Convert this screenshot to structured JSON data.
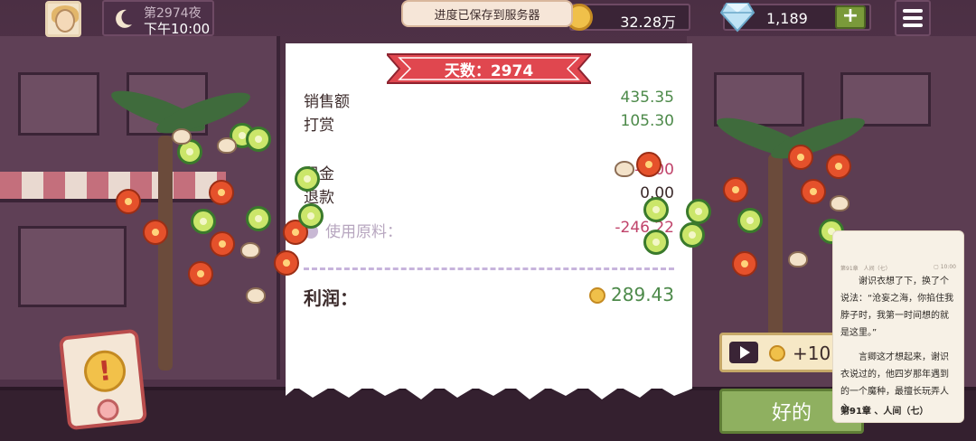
{
  "top_bar": {
    "night_label": "第2974夜",
    "time_label": "下午10:00",
    "coins": "32.28万",
    "gems": "1,189",
    "add_label": "+"
  },
  "toast": {
    "text": "进度已保存到服务器"
  },
  "receipt": {
    "day_title": "天数：2974",
    "sales_label": "销售额",
    "sales_value": "435.35",
    "tips_label": "打赏",
    "tips_value": "105.30",
    "rent_label": "租金",
    "rent_value": "-5.00",
    "refund_label": "退款",
    "refund_value": "0.00",
    "ingredients_label": "使用原料：",
    "ingredients_value": "-246.22",
    "profit_label": "利润：",
    "profit_value": "289.43"
  },
  "ad_button": {
    "reward_label": "+10"
  },
  "ok_button": {
    "label": "好的"
  },
  "reader": {
    "header_left": "第91章　人间（七）",
    "header_right": "▢ 10:00",
    "paragraphs": [
      "谢识衣想了下，换了个说法：“沧妄之海，你掐住我脖子时，我第一时间想的就是这里。”",
      "言卿这才想起来，谢识衣说过的，他四岁那年遇到的一个魔种，最擅长玩弄人心。"
    ],
    "chapter_title": "第91章 、人间（七）"
  },
  "colors": {
    "positive": "#4d8a4a",
    "negative": "#c0436a",
    "ribbon": "#e0474f",
    "ok_button": "#8fb060"
  },
  "icons": [
    "moon-icon",
    "coin-icon",
    "diamond-icon",
    "menu-icon",
    "alert-icon",
    "play-icon",
    "info-icon"
  ]
}
